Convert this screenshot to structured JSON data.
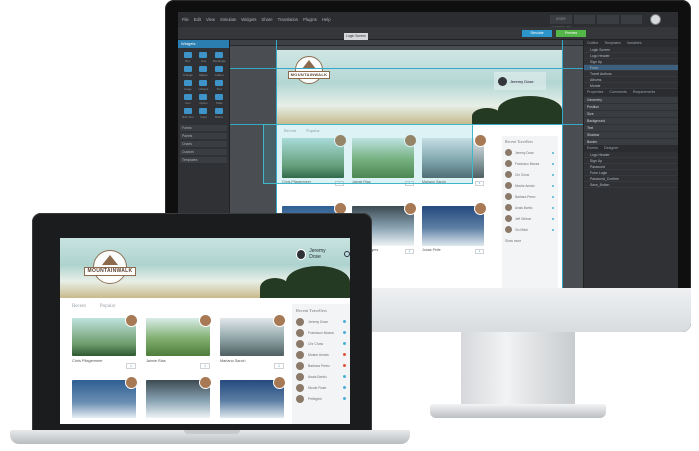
{
  "colors": {
    "accent_blue": "#2c95c9",
    "accent_green": "#54b548",
    "selection": "#40b7c8",
    "online": "#4bb0d8",
    "away": "#e0533c"
  },
  "ide": {
    "menu": [
      "File",
      "Edit",
      "View",
      "Simulate",
      "Widgets",
      "Share",
      "Translation",
      "Plugins",
      "Help"
    ],
    "title_tabs": [
      "USER INTERFACE",
      "",
      "",
      ""
    ],
    "page_tab": "Login Screen",
    "toolbar_blue": "Simulate",
    "toolbar_green": "Preview",
    "left_header": "Widgets",
    "widgets": [
      "Box",
      "Line",
      "Rectangle",
      "Triangle",
      "Ellipse",
      "Callout",
      "Image",
      "Hotspot",
      "Text",
      "Icon",
      "Option",
      "Table",
      "Rich Text",
      "Input",
      "Button",
      "Icon",
      "Select",
      "Slider"
    ],
    "left_sections": [
      "Forms",
      "Panels",
      "Charts",
      "Custom",
      "Templates"
    ],
    "right_tabs": [
      "Outline",
      "Templates",
      "Variables"
    ],
    "tree": [
      "Login Screen",
      "Logo Header",
      "Sign Up",
      "Form",
      "Travel Authors",
      "Albums",
      "Monde"
    ],
    "props_tabs": [
      "Properties",
      "Comments",
      "Requirements"
    ],
    "props_sections": [
      "Geometry",
      "Position",
      "Size",
      "Background",
      "Text",
      "Shadow",
      "Border"
    ],
    "events_tabs": [
      "Events",
      "Designer"
    ],
    "events": [
      "Logo Header",
      "Sign Up",
      "Password",
      "Form Login",
      "Password_Confirm",
      "Save_Button"
    ]
  },
  "site": {
    "logo_text": "MOUNTAINWALK",
    "user_name": "Jeremy Dose",
    "tabs": [
      "Recent",
      "Popular"
    ],
    "sidebar_title": "Recent Travellers",
    "travellers_imac": [
      "Jeremy Dose",
      "Francisco Mossa",
      "Chr Chow",
      "Moshe Amato",
      "Barbara Perez",
      "Anais Barbu",
      "Jeff Gibbon",
      "Vio Mitch"
    ],
    "travellers_laptop": [
      "Jeremy Dose",
      "Francisco Mossa",
      "Chr Chow",
      "Moshe Amato",
      "Barbara Perez",
      "Anais Barbu",
      "Nicole Rose",
      "Pellegrini"
    ],
    "show_more": "Show more",
    "cards_imac": [
      {
        "name": "Chris Pflagermeer",
        "like": "1"
      },
      {
        "name": "Jaimie Rias",
        "like": "1"
      },
      {
        "name": "Mariano Sanch",
        "like": "1"
      },
      {
        "name": "Ramsey Goren",
        "like": "1"
      },
      {
        "name": "Moodie Bengers",
        "like": "1"
      },
      {
        "name": "Jonas Pelle",
        "like": "1"
      }
    ],
    "cards_laptop": [
      {
        "name": "Chris Pflagermeer",
        "like": "1"
      },
      {
        "name": "Jaimie Rias",
        "like": "1"
      },
      {
        "name": "Mariano Sanch",
        "like": "1"
      },
      {
        "name": "",
        "like": ""
      },
      {
        "name": "",
        "like": ""
      },
      {
        "name": "",
        "like": ""
      }
    ]
  }
}
